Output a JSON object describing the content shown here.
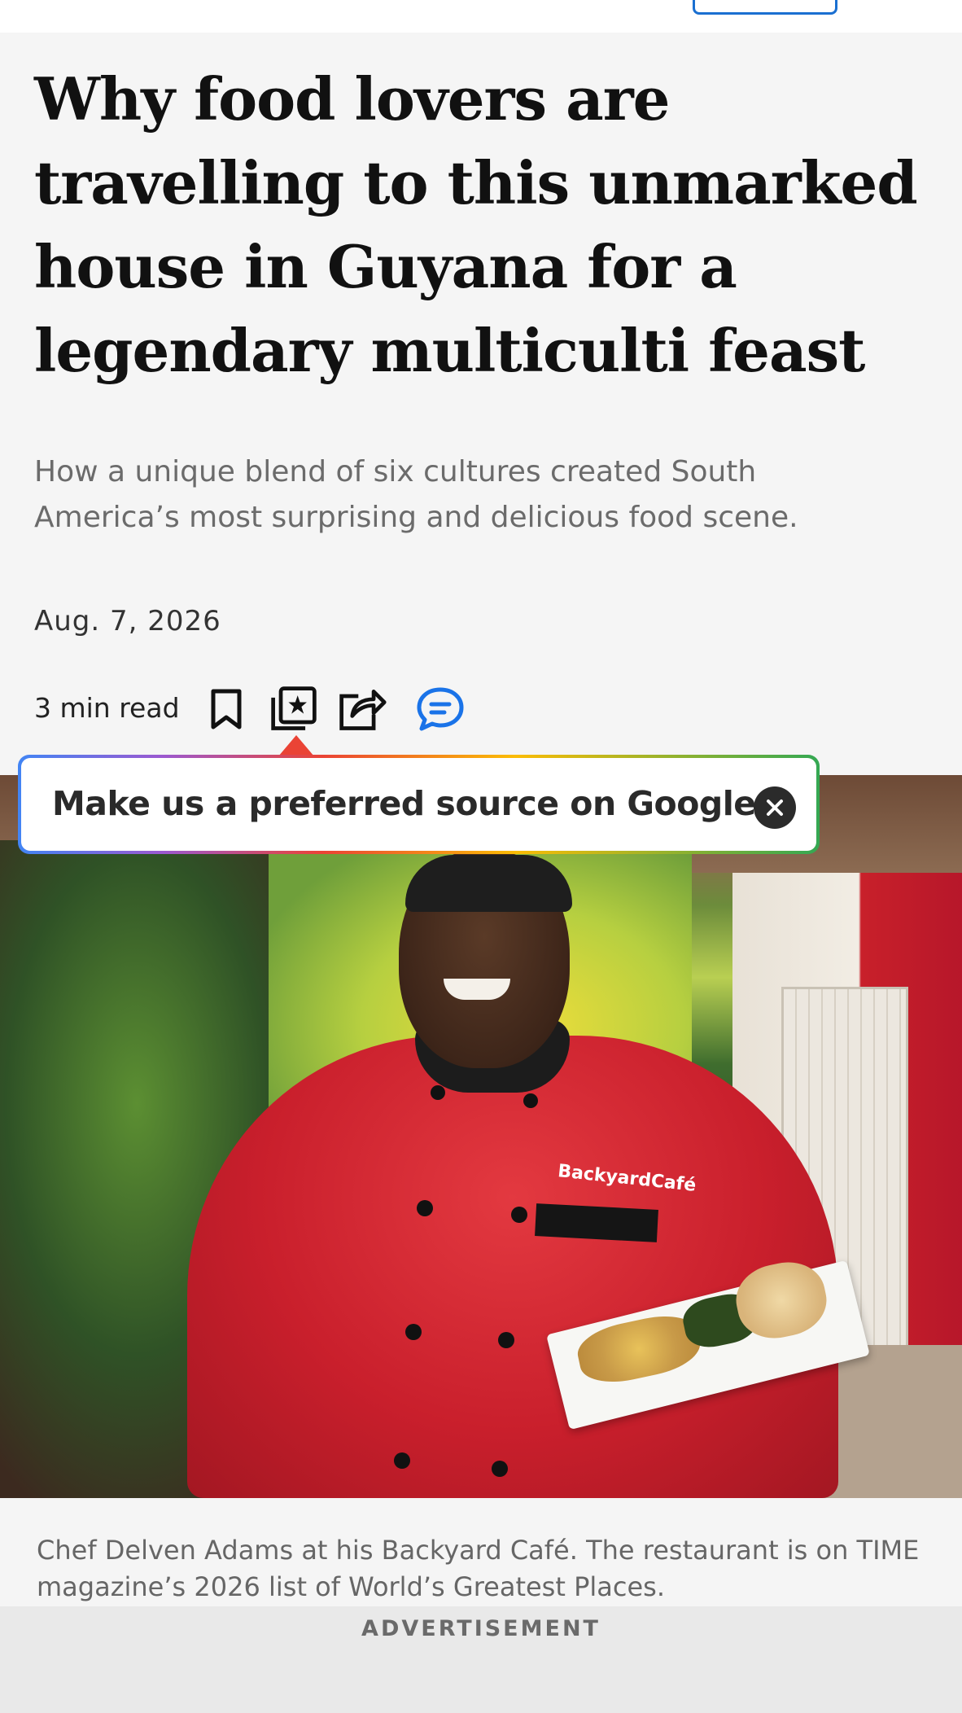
{
  "article": {
    "headline": "Why food lovers are travelling to this unmarked house in Guyana for a legendary multiculti feast",
    "dek": "How a unique blend of six cultures created South America’s most surprising and delicious food scene.",
    "date": "Aug. 7, 2026",
    "read_time": "3 min read",
    "image_caption": "Chef Delven Adams at his Backyard Café. The restaurant is on TIME magazine’s 2026 list of World’s Greatest Places."
  },
  "actions": {
    "icons": [
      "bookmark-icon",
      "gift-article-icon",
      "share-icon",
      "comments-icon"
    ],
    "comments_color": "#1a73e8"
  },
  "popup": {
    "text": "Make us a preferred source on Google",
    "close_icon": "close-icon"
  },
  "hero_image": {
    "shirt_text": "BackyardCafé"
  },
  "ad": {
    "label": "ADVERTISEMENT"
  },
  "colors": {
    "accent": "#1a6fd1",
    "google_gradient": [
      "#4285f4",
      "#ea4335",
      "#fbbc05",
      "#34a853"
    ]
  }
}
